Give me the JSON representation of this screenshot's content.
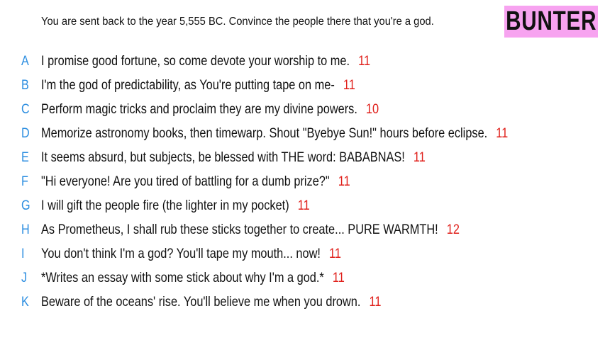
{
  "prompt": "You are sent back to the year 5,555 BC. Convince the people there that you're a god.",
  "logo": "BUNTER",
  "answers": [
    {
      "letter": "A",
      "text": "I promise good fortune, so come devote your worship to me.",
      "score": "11"
    },
    {
      "letter": "B",
      "text": "I'm the god of predictability, as You're putting tape on me-",
      "score": "11"
    },
    {
      "letter": "C",
      "text": "Perform magic tricks and proclaim they are my divine powers.",
      "score": "10"
    },
    {
      "letter": "D",
      "text": "Memorize astronomy books, then timewarp. Shout \"Byebye Sun!\" hours before eclipse.",
      "score": "11"
    },
    {
      "letter": "E",
      "text": "It seems absurd, but subjects, be blessed with THE word: BABABNAS!",
      "score": "11"
    },
    {
      "letter": "F",
      "text": "\"Hi everyone! Are you tired of battling for a dumb prize?\"",
      "score": "11"
    },
    {
      "letter": "G",
      "text": "I will gift the people fire (the lighter in my pocket)",
      "score": "11"
    },
    {
      "letter": "H",
      "text": "As Prometheus, I shall rub these sticks together to create... PURE WARMTH!",
      "score": "12"
    },
    {
      "letter": "I",
      "text": "You don't think I'm a god? You'll tape my mouth... now!",
      "score": "11"
    },
    {
      "letter": "J",
      "text": "*Writes an essay with some stick about why I'm a god.*",
      "score": "11"
    },
    {
      "letter": "K",
      "text": "Beware of the oceans' rise. You'll believe me when you drown.",
      "score": "11"
    }
  ],
  "colors": {
    "letter": "#2b8de0",
    "score": "#e0201b",
    "logo_bg": "#f7a3f0"
  }
}
